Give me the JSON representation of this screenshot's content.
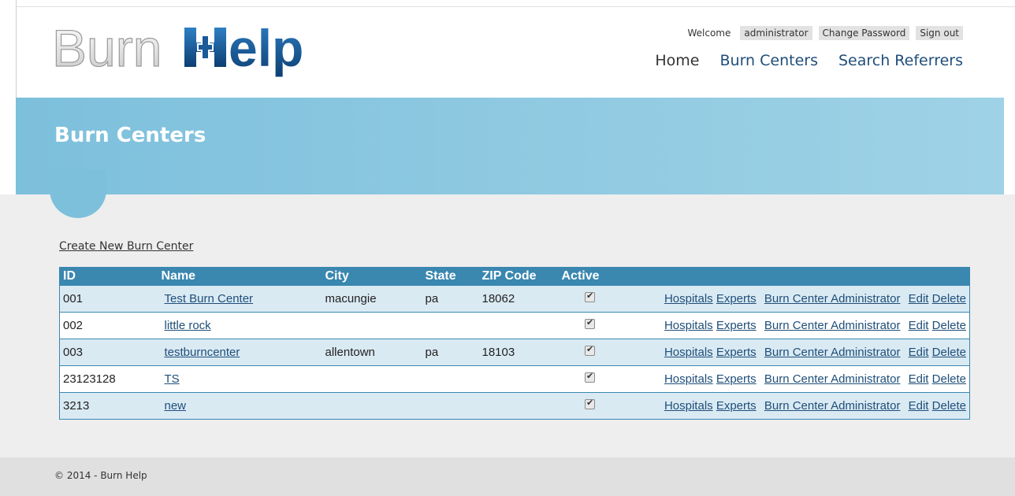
{
  "brand": {
    "logo_text": "BurnHelp"
  },
  "topbar": {
    "welcome": "Welcome",
    "user": "administrator",
    "change_password": "Change Password",
    "sign_out": "Sign out"
  },
  "nav": {
    "home": "Home",
    "burn_centers": "Burn Centers",
    "search_referrers": "Search Referrers"
  },
  "page": {
    "title": "Burn Centers",
    "create_link": "Create New Burn Center"
  },
  "table": {
    "headers": {
      "id": "ID",
      "name": "Name",
      "city": "City",
      "state": "State",
      "zip": "ZIP Code",
      "active": "Active"
    },
    "rows": [
      {
        "id": "001",
        "name": "Test Burn Center",
        "city": "macungie",
        "state": "pa",
        "zip": "18062",
        "active": true
      },
      {
        "id": "002",
        "name": "little rock",
        "city": "",
        "state": "",
        "zip": "",
        "active": true
      },
      {
        "id": "003",
        "name": "testburncenter",
        "city": "allentown",
        "state": "pa",
        "zip": "18103",
        "active": true
      },
      {
        "id": "23123128",
        "name": "TS",
        "city": "",
        "state": "",
        "zip": "",
        "active": true
      },
      {
        "id": "3213",
        "name": "new",
        "city": "",
        "state": "",
        "zip": "",
        "active": true
      }
    ],
    "actions": {
      "hospitals": "Hospitals",
      "experts": "Experts",
      "admin": "Burn Center Administrator",
      "edit": "Edit",
      "delete": "Delete"
    }
  },
  "footer": {
    "text": "© 2014 - Burn Help"
  },
  "colors": {
    "banner": "#7dc0dc",
    "header_row": "#3a87b0",
    "alt_row": "#daeaf3",
    "link": "#1f4e79"
  }
}
